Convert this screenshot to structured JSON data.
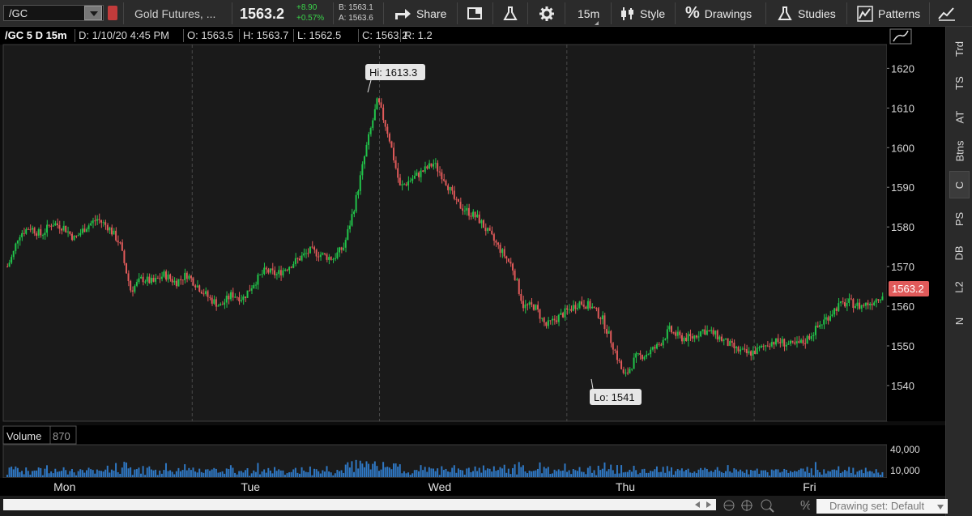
{
  "toolbar": {
    "symbol": "/GC",
    "description": "Gold Futures, ...",
    "last_price": "1563.2",
    "net_change": "+8.90",
    "pct_change": "+0.57%",
    "bid": "B: 1563.1",
    "ask": "A: 1563.6",
    "share_label": "Share",
    "timeframe_label": "15m",
    "style_label": "Style",
    "drawings_label": "Drawings",
    "studies_label": "Studies",
    "patterns_label": "Patterns",
    "colors": {
      "up": "#21c44a",
      "down": "#e05a5a",
      "accent": "#4aa3ff"
    }
  },
  "header": {
    "chart_label": "/GC 5 D 15m",
    "date": "D: 1/10/20 4:45 PM",
    "open": "O: 1563.5",
    "high": "H: 1563.7",
    "low": "L: 1562.5",
    "close": "C: 1563.2",
    "range": "R: 1.2"
  },
  "chart_data": {
    "type": "candlestick",
    "y_ticks": [
      "1620",
      "1610",
      "1600",
      "1590",
      "1580",
      "1570",
      "1560",
      "1550",
      "1540"
    ],
    "ylim": [
      1531,
      1626
    ],
    "x_labels": [
      "Mon",
      "Tue",
      "Wed",
      "Thu",
      "Fri"
    ],
    "annotations": {
      "high": "Hi: 1613.3",
      "low": "Lo: 1541"
    },
    "last_price_tag": "1563.2",
    "price_path": [
      [
        0,
        1570
      ],
      [
        0.5,
        1573
      ],
      [
        1,
        1578
      ],
      [
        2,
        1580
      ],
      [
        3,
        1578
      ],
      [
        4,
        1581
      ],
      [
        5,
        1580
      ],
      [
        6,
        1577
      ],
      [
        7,
        1580
      ],
      [
        8,
        1582
      ],
      [
        9,
        1580
      ],
      [
        10,
        1576
      ],
      [
        11,
        1564
      ],
      [
        12,
        1567
      ],
      [
        13,
        1566
      ],
      [
        14,
        1568
      ],
      [
        15,
        1566
      ],
      [
        16,
        1568
      ],
      [
        17,
        1565
      ],
      [
        18,
        1562
      ],
      [
        19,
        1560
      ],
      [
        20,
        1563
      ],
      [
        21,
        1562
      ],
      [
        22,
        1566
      ],
      [
        23,
        1569
      ],
      [
        24,
        1568
      ],
      [
        25,
        1570
      ],
      [
        26,
        1572
      ],
      [
        27,
        1574
      ],
      [
        28,
        1573
      ],
      [
        29,
        1572
      ],
      [
        30,
        1575
      ],
      [
        31,
        1586
      ],
      [
        32,
        1600
      ],
      [
        33,
        1612
      ],
      [
        34,
        1603
      ],
      [
        35,
        1590
      ],
      [
        36,
        1592
      ],
      [
        37,
        1594
      ],
      [
        38,
        1596
      ],
      [
        39,
        1592
      ],
      [
        40,
        1586
      ],
      [
        41,
        1584
      ],
      [
        42,
        1582
      ],
      [
        43,
        1578
      ],
      [
        44,
        1574
      ],
      [
        45,
        1570
      ],
      [
        46,
        1560
      ],
      [
        47,
        1560
      ],
      [
        48,
        1555
      ],
      [
        49,
        1557
      ],
      [
        50,
        1559
      ],
      [
        51,
        1561
      ],
      [
        52,
        1560
      ],
      [
        53,
        1557
      ],
      [
        54,
        1550
      ],
      [
        55,
        1542
      ],
      [
        56,
        1547
      ],
      [
        57,
        1548
      ],
      [
        58,
        1550
      ],
      [
        59,
        1554
      ],
      [
        60,
        1552
      ],
      [
        61,
        1552
      ],
      [
        62,
        1554
      ],
      [
        63,
        1553
      ],
      [
        64,
        1551
      ],
      [
        65,
        1549
      ],
      [
        66,
        1548
      ],
      [
        67,
        1549
      ],
      [
        68,
        1551
      ],
      [
        69,
        1551
      ],
      [
        70,
        1550
      ],
      [
        71,
        1551
      ],
      [
        72,
        1554
      ],
      [
        73,
        1557
      ],
      [
        74,
        1560
      ],
      [
        75,
        1561
      ],
      [
        76,
        1560
      ],
      [
        77,
        1561
      ],
      [
        78,
        1563
      ]
    ],
    "volume_label": "Volume",
    "volume_value": "870",
    "volume_ticks": [
      "40,000",
      "10,000"
    ],
    "volume_ylim": [
      0,
      50000
    ]
  },
  "right_tabs": [
    "Trd",
    "TS",
    "AT",
    "Btns",
    "C",
    "PS",
    "DB",
    "L2",
    "N"
  ],
  "active_tab": "C",
  "bottom": {
    "drawing_set": "Drawing set: Default"
  }
}
